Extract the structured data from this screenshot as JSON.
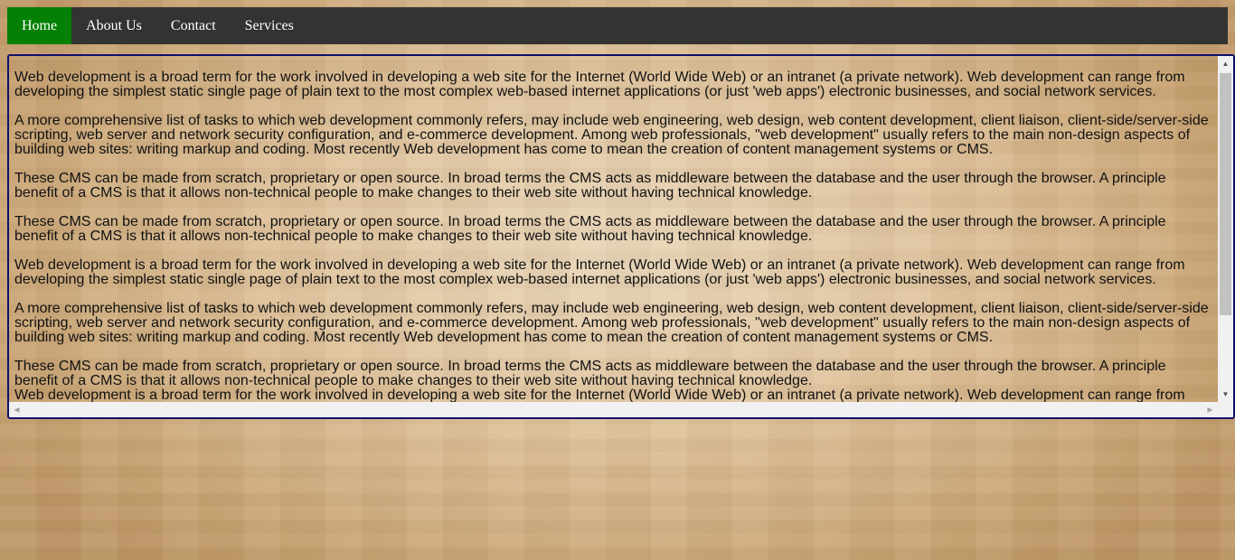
{
  "nav": {
    "items": [
      {
        "label": "Home",
        "active": true
      },
      {
        "label": "About Us",
        "active": false
      },
      {
        "label": "Contact",
        "active": false
      },
      {
        "label": "Services",
        "active": false
      }
    ]
  },
  "content": {
    "paragraphs": [
      "Web development is a broad term for the work involved in developing a web site for the Internet (World Wide Web) or an intranet (a private network). Web development can range from developing the simplest static single page of plain text to the most complex web-based internet applications (or just 'web apps') electronic businesses, and social network services.",
      "A more comprehensive list of tasks to which web development commonly refers, may include web engineering, web design, web content development, client liaison, client-side/server-side scripting, web server and network security configuration, and e-commerce development. Among web professionals, \"web development\" usually refers to the main non-design aspects of building web sites: writing markup and coding. Most recently Web development has come to mean the creation of content management systems or CMS.",
      "These CMS can be made from scratch, proprietary or open source. In broad terms the CMS acts as middleware between the database and the user through the browser. A principle benefit of a CMS is that it allows non-technical people to make changes to their web site without having technical knowledge.",
      "These CMS can be made from scratch, proprietary or open source. In broad terms the CMS acts as middleware between the database and the user through the browser. A principle benefit of a CMS is that it allows non-technical people to make changes to their web site without having technical knowledge.",
      "Web development is a broad term for the work involved in developing a web site for the Internet (World Wide Web) or an intranet (a private network). Web development can range from developing the simplest static single page of plain text to the most complex web-based internet applications (or just 'web apps') electronic businesses, and social network services.",
      "A more comprehensive list of tasks to which web development commonly refers, may include web engineering, web design, web content development, client liaison, client-side/server-side scripting, web server and network security configuration, and e-commerce development. Among web professionals, \"web development\" usually refers to the main non-design aspects of building web sites: writing markup and coding. Most recently Web development has come to mean the creation of content management systems or CMS.",
      "These CMS can be made from scratch, proprietary or open source. In broad terms the CMS acts as middleware between the database and the user through the browser. A principle benefit of a CMS is that it allows non-technical people to make changes to their web site without having technical knowledge.",
      "Web development is a broad term for the work involved in developing a web site for the Internet (World Wide Web) or an intranet (a private network). Web development can range from developing the simplest static single page of plain text to the most complex web-based internet applications (or just 'web apps') electronic businesses, and social network services."
    ]
  },
  "scrollbars": {
    "up_icon": "arrow-up-icon",
    "down_icon": "arrow-down-icon",
    "left_icon": "arrow-left-icon",
    "right_icon": "arrow-right-icon"
  },
  "colors": {
    "nav_bg": "#333333",
    "nav_active": "#048004",
    "box_border": "#10106a"
  }
}
